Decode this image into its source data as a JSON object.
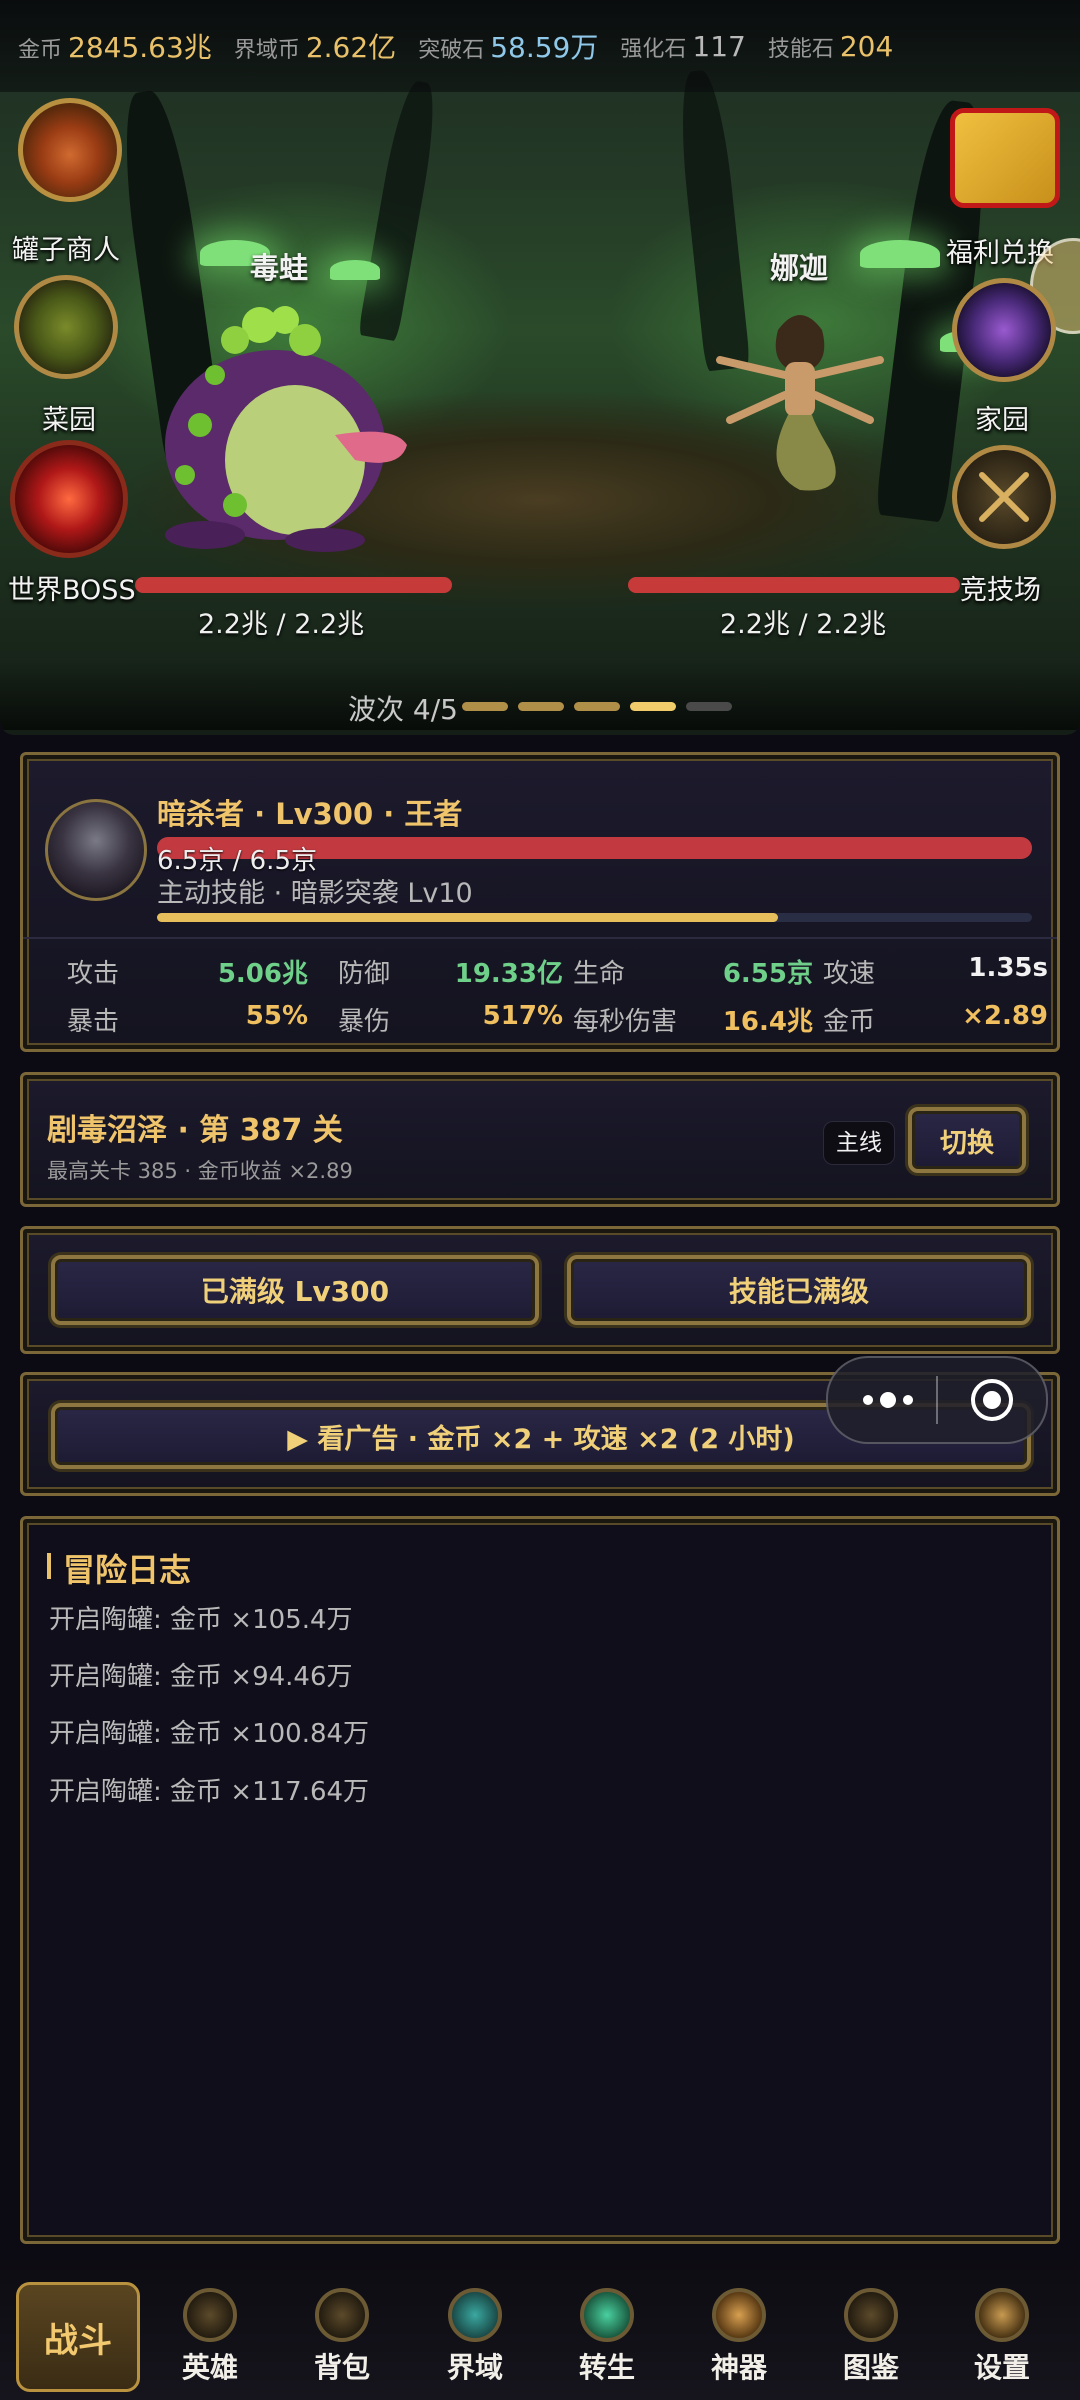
{
  "currencies": [
    {
      "label": "金币",
      "value": "2845.63兆",
      "color": "#e9c16a"
    },
    {
      "label": "界域币",
      "value": "2.62亿",
      "color": "#e9c16a"
    },
    {
      "label": "突破石",
      "value": "58.59万",
      "color": "#8fc8e8"
    },
    {
      "label": "强化石",
      "value": "117",
      "color": "#b9b9b9"
    },
    {
      "label": "技能石",
      "value": "204",
      "color": "#e9c16a"
    }
  ],
  "side_left": [
    {
      "label": "罐子商人",
      "icon": "pot-merchant-icon"
    },
    {
      "label": "菜园",
      "icon": "vegetable-garden-icon"
    },
    {
      "label": "世界BOSS",
      "icon": "world-boss-icon"
    }
  ],
  "side_right": [
    {
      "label": "福利兑换",
      "icon": "gift-box-icon"
    },
    {
      "label": "家园",
      "icon": "castle-icon"
    },
    {
      "label": "竞技场",
      "icon": "crossed-swords-icon"
    }
  ],
  "enemies": [
    {
      "name": "毒蛙",
      "hp": "2.2兆 / 2.2兆",
      "hp_fraction": 1.0
    },
    {
      "name": "娜迦",
      "hp": "2.2兆 / 2.2兆",
      "hp_fraction": 1.0
    }
  ],
  "wave": {
    "label": "波次 4/5",
    "current": 4,
    "total": 5
  },
  "hero": {
    "title": "暗杀者 · Lv300 · 王者",
    "hp": "6.5京 / 6.5京",
    "hp_fraction": 1.0,
    "skill": "主动技能 · 暗影突袭 Lv10",
    "skill_progress": 0.71,
    "stats": [
      [
        {
          "label": "攻击",
          "value": "5.06兆",
          "color": "#6fd08a"
        },
        {
          "label": "防御",
          "value": "19.33亿",
          "color": "#6fd08a"
        },
        {
          "label": "生命",
          "value": "6.55京",
          "color": "#6fd08a"
        },
        {
          "label": "攻速",
          "value": "1.35s",
          "color": "#f2f2f2"
        }
      ],
      [
        {
          "label": "暴击",
          "value": "55%",
          "color": "#f0c060"
        },
        {
          "label": "暴伤",
          "value": "517%",
          "color": "#f0c060"
        },
        {
          "label": "每秒伤害",
          "value": "16.4兆",
          "color": "#f0c060"
        },
        {
          "label": "金币",
          "value": "×2.89",
          "color": "#f0c060"
        }
      ]
    ]
  },
  "stage": {
    "title": "剧毒沼泽 · 第 387 关",
    "sub": "最高关卡 385 · 金币收益 ×2.89",
    "tag": "主线",
    "switch_label": "切换"
  },
  "upgrade": {
    "level_label": "已满级 Lv300",
    "skill_label": "技能已满级"
  },
  "ad": {
    "label": "▶ 看广告 · 金币 ×2 + 攻速 ×2 (2 小时)"
  },
  "log": {
    "title": "冒险日志",
    "lines": [
      "开启陶罐: 金币 ×105.4万",
      "开启陶罐: 金币 ×94.46万",
      "开启陶罐: 金币 ×100.84万",
      "开启陶罐: 金币 ×117.64万"
    ]
  },
  "nav": [
    {
      "label": "战斗",
      "active": true
    },
    {
      "label": "英雄",
      "icon": "hero-icon"
    },
    {
      "label": "背包",
      "icon": "backpack-icon"
    },
    {
      "label": "界域",
      "icon": "realm-icon"
    },
    {
      "label": "转生",
      "icon": "rebirth-icon"
    },
    {
      "label": "神器",
      "icon": "artifact-icon"
    },
    {
      "label": "图鉴",
      "icon": "codex-icon"
    },
    {
      "label": "设置",
      "icon": "settings-icon"
    }
  ]
}
